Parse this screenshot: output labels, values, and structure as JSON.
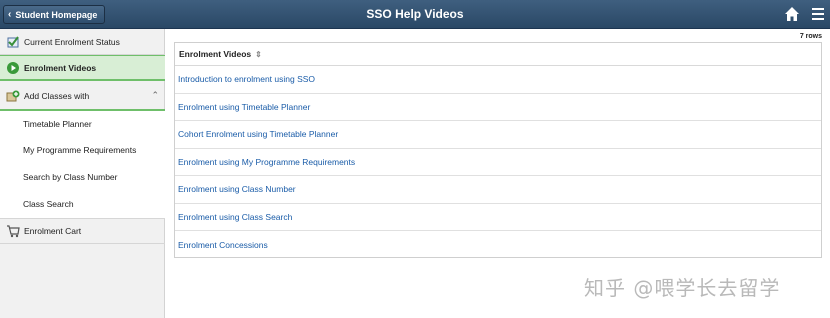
{
  "header": {
    "back_label": "Student Homepage",
    "title": "SSO Help Videos",
    "home_icon": "home-icon",
    "menu_icon": "hamburger-menu-icon",
    "bar_color": "#2f4e6e"
  },
  "sidebar": {
    "items": [
      {
        "label": "Current Enrolment Status",
        "icon": "checklist-icon"
      },
      {
        "label": "Enrolment Videos",
        "icon": "play-circle-icon"
      },
      {
        "label": "Add Classes with",
        "icon": "add-classes-icon"
      },
      {
        "label": "Enrolment Cart",
        "icon": "cart-icon"
      }
    ],
    "subitems": [
      {
        "label": "Timetable Planner"
      },
      {
        "label": "My Programme Requirements"
      },
      {
        "label": "Search by Class Number"
      },
      {
        "label": "Class Search"
      }
    ],
    "active_color": "#d8eed5"
  },
  "grid": {
    "row_count": "7 rows",
    "header": "Enrolment Videos",
    "rows": [
      "Introduction to enrolment using SSO",
      "Enrolment using Timetable Planner",
      "Cohort Enrolment using Timetable Planner",
      "Enrolment using My Programme Requirements",
      "Enrolment using Class Number",
      "Enrolment using Class Search",
      "Enrolment Concessions"
    ],
    "link_color": "#1a5ca8"
  },
  "watermark": "知乎 @喂学长去留学"
}
